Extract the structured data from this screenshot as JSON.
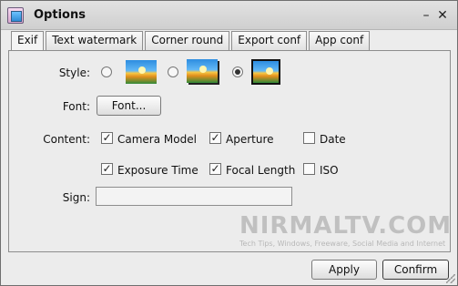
{
  "window": {
    "title": "Options",
    "minimize_glyph": "–",
    "close_glyph": "✕"
  },
  "tabs": [
    {
      "label": "Exif",
      "active": true
    },
    {
      "label": "Text watermark",
      "active": false
    },
    {
      "label": "Corner round",
      "active": false
    },
    {
      "label": "Export conf",
      "active": false
    },
    {
      "label": "App conf",
      "active": false
    }
  ],
  "style": {
    "label": "Style:",
    "options": [
      {
        "name": "plain",
        "checked": false
      },
      {
        "name": "shadow",
        "checked": false
      },
      {
        "name": "framed",
        "checked": true
      }
    ]
  },
  "font": {
    "label": "Font:",
    "button": "Font..."
  },
  "content": {
    "label": "Content:",
    "items": [
      {
        "label": "Camera Model",
        "checked": true
      },
      {
        "label": "Aperture",
        "checked": true
      },
      {
        "label": "Date",
        "checked": false
      },
      {
        "label": "Exposure Time",
        "checked": true
      },
      {
        "label": "Focal Length",
        "checked": true
      },
      {
        "label": "ISO",
        "checked": false
      }
    ]
  },
  "sign": {
    "label": "Sign:",
    "value": ""
  },
  "watermark": {
    "main": "NIRMALTV.COM",
    "sub": "Tech Tips, Windows, Freeware, Social Media and Internet"
  },
  "footer": {
    "apply": "Apply",
    "confirm": "Confirm"
  },
  "colors": {
    "window_bg": "#ececec",
    "titlebar": "#d8d8d8"
  }
}
